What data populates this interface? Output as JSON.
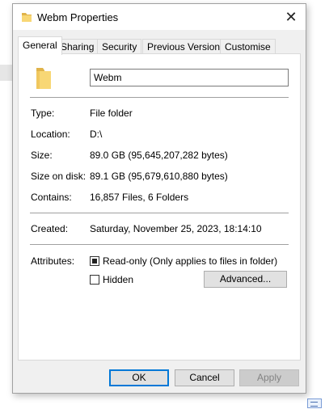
{
  "window": {
    "title": "Webm Properties",
    "close_glyph": "✕"
  },
  "tabs": [
    {
      "label": "General",
      "active": true
    },
    {
      "label": "Sharing"
    },
    {
      "label": "Security"
    },
    {
      "label": "Previous Versions"
    },
    {
      "label": "Customise"
    }
  ],
  "general": {
    "name_value": "Webm",
    "rows": [
      {
        "label": "Type:",
        "value": "File folder"
      },
      {
        "label": "Location:",
        "value": "D:\\"
      },
      {
        "label": "Size:",
        "value": "89.0 GB (95,645,207,282 bytes)"
      },
      {
        "label": "Size on disk:",
        "value": "89.1 GB (95,679,610,880 bytes)"
      },
      {
        "label": "Contains:",
        "value": "16,857 Files, 6 Folders"
      }
    ],
    "created_label": "Created:",
    "created_value": "Saturday, November 25, 2023, 18:14:10",
    "attributes_label": "Attributes:",
    "readonly_label": "Read-only (Only applies to files in folder)",
    "readonly_state": "indeterminate",
    "hidden_label": "Hidden",
    "hidden_checked": false,
    "advanced_label": "Advanced..."
  },
  "footer": {
    "ok_label": "OK",
    "cancel_label": "Cancel",
    "apply_label": "Apply"
  },
  "icons": {
    "folder": "folder-icon",
    "close": "close-icon"
  },
  "colors": {
    "folder_yellow": "#f8d775",
    "folder_dark": "#e0b34a",
    "accent": "#0078d7"
  }
}
